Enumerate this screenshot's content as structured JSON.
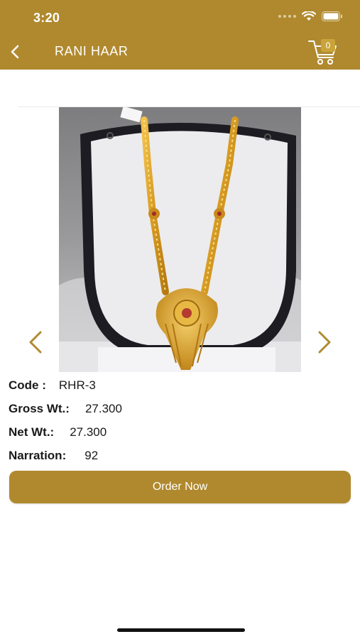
{
  "status_bar": {
    "time": "3:20"
  },
  "header": {
    "title": "RANI HAAR",
    "cart_count": "0"
  },
  "product": {
    "image_icon": "gold-necklace-photo",
    "details": [
      {
        "label": "Code :",
        "value": "RHR-3"
      },
      {
        "label": "Gross Wt.:",
        "value": "27.300"
      },
      {
        "label": "Net Wt.:",
        "value": "27.300"
      },
      {
        "label": "Narration:",
        "value": "92"
      }
    ]
  },
  "actions": {
    "order_label": "Order Now"
  },
  "colors": {
    "accent": "#b0892e",
    "arrow": "#b08a30"
  },
  "icons": {
    "back": "chevron-left-icon",
    "cart": "cart-icon",
    "prev": "chevron-left-icon",
    "next": "chevron-right-icon"
  }
}
